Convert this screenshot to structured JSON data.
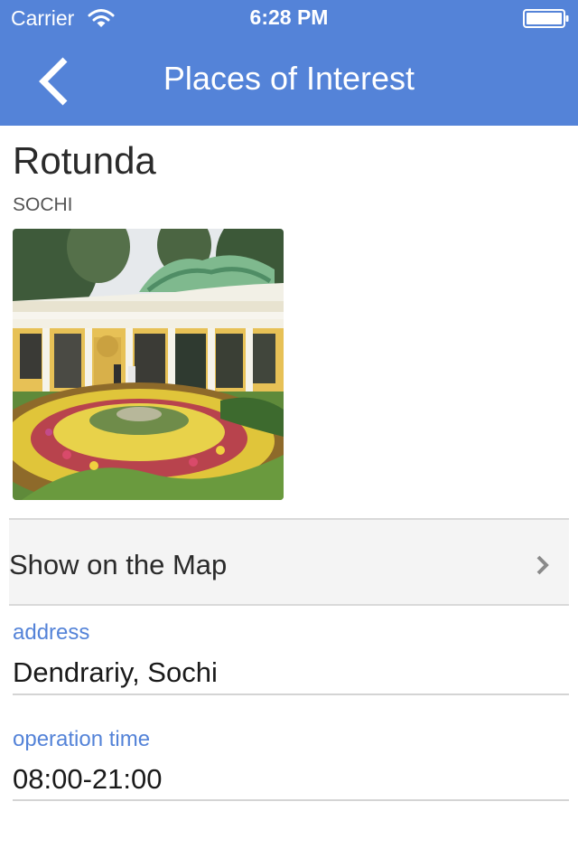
{
  "status_bar": {
    "carrier": "Carrier",
    "time": "6:28 PM",
    "wifi_icon": "wifi-icon",
    "battery_icon": "battery-icon"
  },
  "nav": {
    "title": "Places of Interest",
    "back_icon": "chevron-left-icon",
    "background_color": "#5483d8"
  },
  "place": {
    "title": "Rotunda",
    "city": "SOCHI",
    "photo": "rotunda-photo"
  },
  "map_row": {
    "label": "Show on the Map",
    "icon": "chevron-right-icon"
  },
  "fields": [
    {
      "label": "address",
      "value": "Dendrariy, Sochi"
    },
    {
      "label": "operation time",
      "value": "08:00-21:00"
    }
  ],
  "colors": {
    "accent": "#5483d8",
    "row_background": "#f4f4f4",
    "divider": "#d4d4d4"
  }
}
